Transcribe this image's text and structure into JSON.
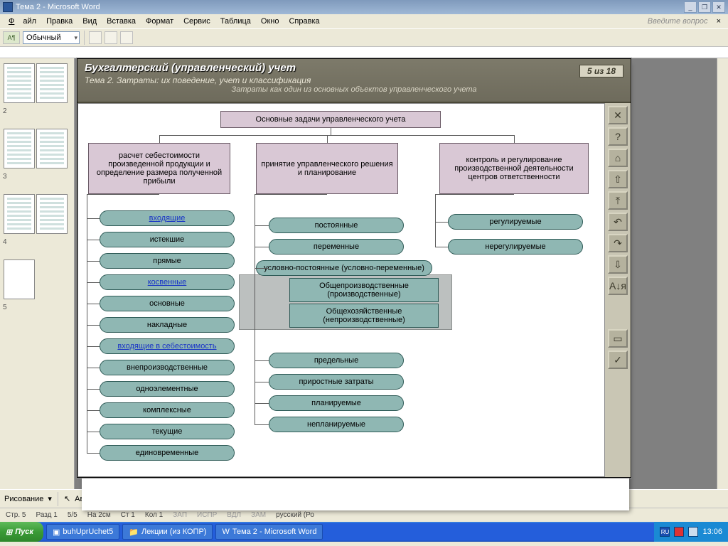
{
  "window": {
    "title": "Тема 2 - Microsoft Word"
  },
  "menu": {
    "file": "Файл",
    "edit": "Правка",
    "view": "Вид",
    "insert": "Вставка",
    "format": "Формат",
    "service": "Сервис",
    "table": "Таблица",
    "window": "Окно",
    "help": "Справка",
    "ask": "Введите вопрос"
  },
  "toolbar": {
    "style": "Обычный"
  },
  "thumbs": {
    "n2": "2",
    "n3": "3",
    "n4": "4",
    "n5": "5"
  },
  "course": {
    "title": "Бухгалтерский (управленческий) учет",
    "subtitle": "Тема 2. Затраты: их поведение, учет и классификация",
    "section": "Затраты как один из основных объектов управленческого учета",
    "page": "5 из 18",
    "nav": {
      "close": "✕",
      "help": "?",
      "home": "⌂",
      "up": "⇧",
      "top": "⤒",
      "back": "↶",
      "fwd": "↷",
      "down": "⇩",
      "az": "А↓я",
      "note": "▭",
      "check": "✓"
    }
  },
  "diagram": {
    "root": "Основные задачи управленческого учета",
    "top1": "расчет себестоимости произведенной продукции и определение размера полученной прибыли",
    "top2": "принятие управленческого решения и планирование",
    "top3": "контроль и регулирование производственной деятельности центров ответственности",
    "c1": [
      "входящие",
      "истекшие",
      "прямые",
      "косвенные",
      "основные",
      "накладные",
      "входящие в себестоимость",
      "внепроизводственные",
      "одноэлементные",
      "комплексные",
      "текущие",
      "единовременные"
    ],
    "c2a": [
      "постоянные",
      "переменные",
      "условно-постоянные (условно-переменные)"
    ],
    "c2sub": [
      "Общепроизводственные (производственные)",
      "Общехозяйственные (непроизводственные)"
    ],
    "c2b": [
      "предельные",
      "приростные затраты",
      "планируемые",
      "непланируемые"
    ],
    "c3": [
      "регулируемые",
      "нерегулируемые"
    ],
    "links": [
      0,
      3,
      6
    ]
  },
  "draw": {
    "label": "Рисование",
    "autoshapes": "Автофигуры"
  },
  "status": {
    "page": "Стр. 5",
    "sect": "Разд 1",
    "pages": "5/5",
    "at": "На 2см",
    "line": "Ст 1",
    "col": "Кол 1",
    "rec": "ЗАП",
    "trk": "ИСПР",
    "ext": "ВДЛ",
    "ovr": "ЗАМ",
    "lang": "русский (Ро"
  },
  "taskbar": {
    "start": "Пуск",
    "t1": "buhUprUchet5",
    "t2": "Лекции (из КОПР)",
    "t3": "Тема 2 - Microsoft Word",
    "kb": "RU",
    "time": "13:06"
  }
}
